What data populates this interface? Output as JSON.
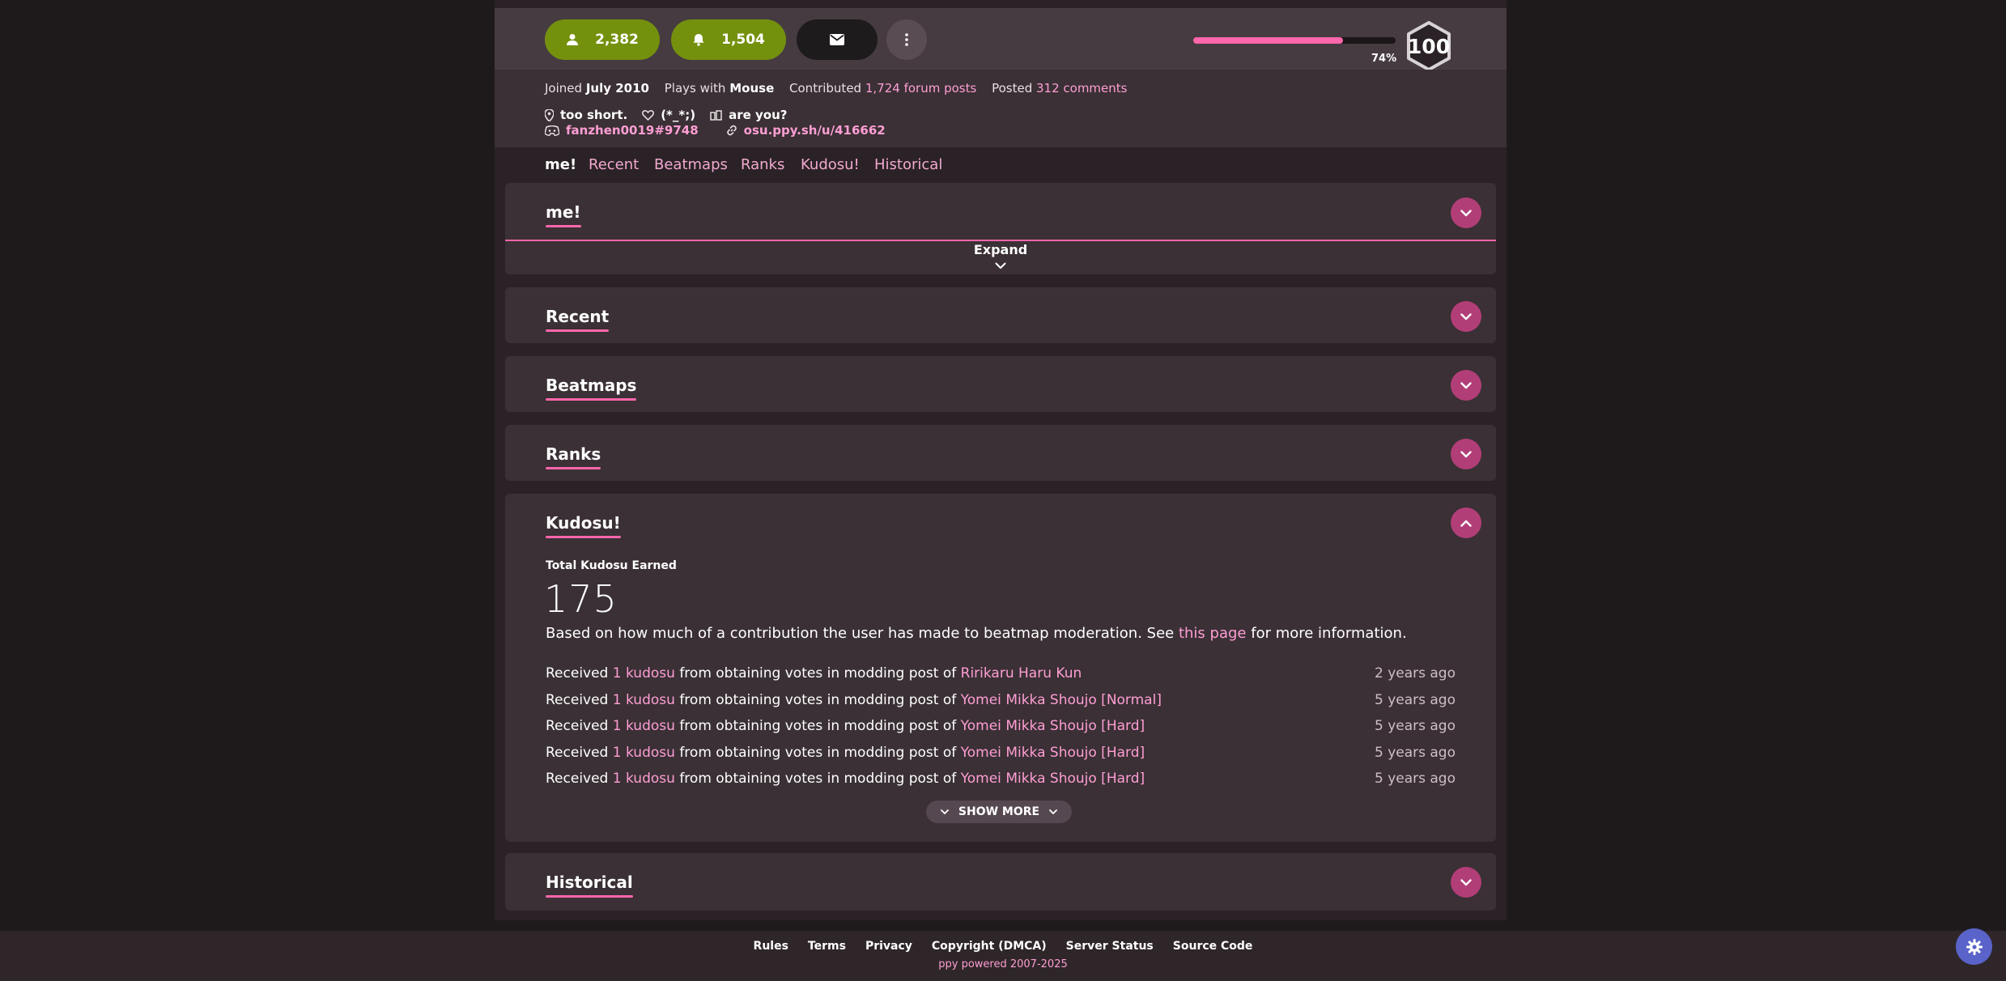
{
  "header": {
    "friends_count": "2,382",
    "followers_count": "1,504",
    "level_progress_percent": 74,
    "level_progress_label": "74%",
    "level": "100"
  },
  "info": {
    "joined_prefix": "Joined",
    "joined_value": "July 2010",
    "plays_prefix": "Plays with",
    "plays_value": "Mouse",
    "contributed_prefix": "Contributed",
    "contributed_value": "1,724 forum posts",
    "posted_prefix": "Posted",
    "posted_value": "312 comments",
    "location": "too short.",
    "interests": "(*_*;)",
    "occupation": "are you?",
    "discord": "fanzhen0019#9748",
    "website": "osu.ppy.sh/u/416662"
  },
  "tabs": [
    "me!",
    "Recent",
    "Beatmaps",
    "Ranks",
    "Kudosu!",
    "Historical"
  ],
  "sections": {
    "me": "me!",
    "expand": "Expand",
    "recent": "Recent",
    "beatmaps": "Beatmaps",
    "ranks": "Ranks",
    "kudosu": "Kudosu!",
    "historical": "Historical"
  },
  "kudosu": {
    "total_label": "Total Kudosu Earned",
    "total": "175",
    "desc_before": "Based on how much of a contribution the user has made to beatmap moderation. See",
    "desc_link": "this page",
    "desc_after": "for more information.",
    "rows": [
      {
        "prefix": "Received",
        "amount": "1 kudosu",
        "middle": "from obtaining votes in modding post of",
        "beatmap": "Ririkaru Haru Kun",
        "time": "2 years ago"
      },
      {
        "prefix": "Received",
        "amount": "1 kudosu",
        "middle": "from obtaining votes in modding post of",
        "beatmap": "Yomei Mikka Shoujo [Normal]",
        "time": "5 years ago"
      },
      {
        "prefix": "Received",
        "amount": "1 kudosu",
        "middle": "from obtaining votes in modding post of",
        "beatmap": "Yomei Mikka Shoujo [Hard]",
        "time": "5 years ago"
      },
      {
        "prefix": "Received",
        "amount": "1 kudosu",
        "middle": "from obtaining votes in modding post of",
        "beatmap": "Yomei Mikka Shoujo [Hard]",
        "time": "5 years ago"
      },
      {
        "prefix": "Received",
        "amount": "1 kudosu",
        "middle": "from obtaining votes in modding post of",
        "beatmap": "Yomei Mikka Shoujo [Hard]",
        "time": "5 years ago"
      }
    ],
    "show_more": "SHOW MORE"
  },
  "footer": {
    "links": [
      "Rules",
      "Terms",
      "Privacy",
      "Copyright (DMCA)",
      "Server Status",
      "Source Code"
    ],
    "copyright": "ppy powered 2007-2025"
  },
  "colors": {
    "accent": "#ff66ab",
    "supporter_green": "#74910e",
    "toggle": "#b23e78"
  }
}
